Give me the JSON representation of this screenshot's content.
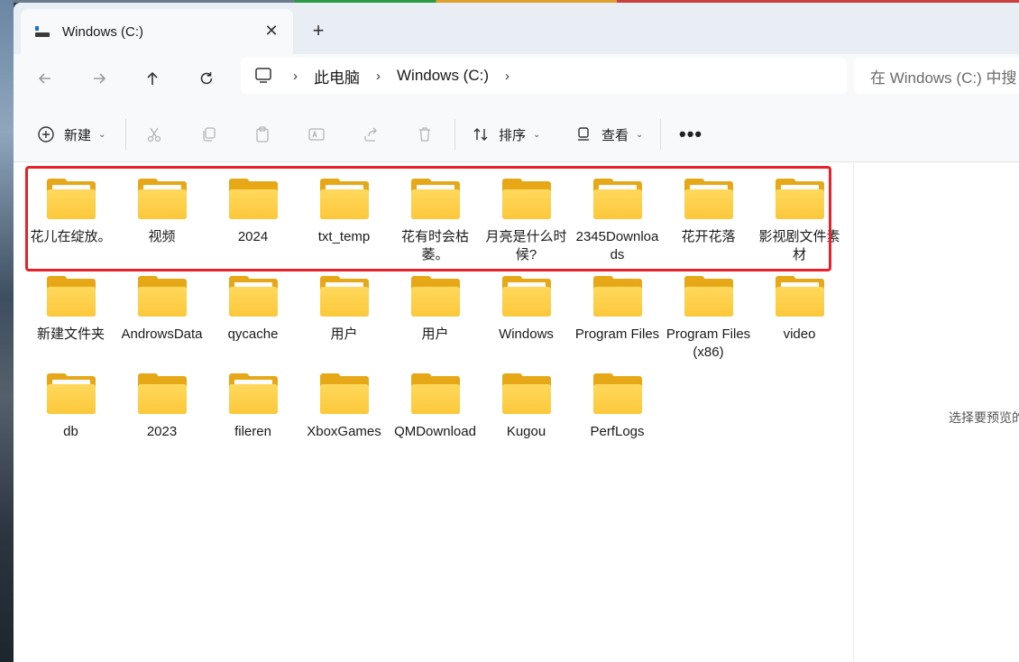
{
  "tab": {
    "title": "Windows (C:)",
    "close": "✕",
    "new_tab": "+"
  },
  "nav": {
    "breadcrumb": [
      "此电脑",
      "Windows (C:)"
    ],
    "search_placeholder": "在 Windows (C:) 中搜"
  },
  "toolbar": {
    "new_label": "新建",
    "sort_label": "排序",
    "view_label": "查看",
    "more_label": "•••"
  },
  "rows": [
    [
      {
        "name": "花儿在绽放。",
        "thumb": true
      },
      {
        "name": "视频",
        "thumb": true
      },
      {
        "name": "2024",
        "thumb": false
      },
      {
        "name": "txt_temp",
        "thumb": true
      },
      {
        "name": "花有时会枯萎。",
        "thumb": true
      },
      {
        "name": "月亮是什么时候?",
        "thumb": false
      },
      {
        "name": "2345Downloads",
        "thumb": true
      },
      {
        "name": "花开花落",
        "thumb": true
      },
      {
        "name": "影视剧文件素材",
        "thumb": true
      }
    ],
    [
      {
        "name": "新建文件夹",
        "thumb": false
      },
      {
        "name": "AndrowsData",
        "thumb": false
      },
      {
        "name": "qycache",
        "thumb": true
      },
      {
        "name": "用户",
        "thumb": true
      },
      {
        "name": "用户",
        "thumb": false
      },
      {
        "name": "Windows",
        "thumb": true
      },
      {
        "name": "Program Files",
        "thumb": false
      },
      {
        "name": "Program Files (x86)",
        "thumb": false
      },
      {
        "name": "video",
        "thumb": true
      }
    ],
    [
      {
        "name": "db",
        "thumb": true
      },
      {
        "name": "2023",
        "thumb": false
      },
      {
        "name": "fileren",
        "thumb": true
      },
      {
        "name": "XboxGames",
        "thumb": false
      },
      {
        "name": "QMDownload",
        "thumb": false
      },
      {
        "name": "Kugou",
        "thumb": false
      },
      {
        "name": "PerfLogs",
        "thumb": false
      }
    ]
  ],
  "preview_hint": "选择要预览的",
  "colors": {
    "folder_front": "#fcc83b",
    "folder_back": "#e6a817",
    "selection": "#e8202a"
  }
}
